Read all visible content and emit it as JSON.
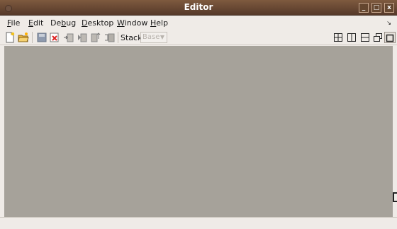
{
  "window": {
    "title": "Editor",
    "controls": {
      "minimize": "_",
      "maximize": "□",
      "close": "x"
    }
  },
  "menubar": {
    "items": [
      {
        "mnemonic": "F",
        "rest": "ile"
      },
      {
        "mnemonic": "E",
        "rest": "dit"
      },
      {
        "pre": "De",
        "mnemonic": "b",
        "rest": "ug"
      },
      {
        "mnemonic": "D",
        "rest": "esktop"
      },
      {
        "mnemonic": "W",
        "rest": "indow"
      },
      {
        "mnemonic": "H",
        "rest": "elp"
      }
    ],
    "overflow_icon": "↘"
  },
  "toolbar": {
    "stack_label": "Stack:",
    "stack_value": "Base",
    "stack_caret": "▼"
  },
  "colors": {
    "title_bar": "#6b4a33",
    "workspace": "#a6a29a",
    "window_bg": "#efebe7"
  }
}
